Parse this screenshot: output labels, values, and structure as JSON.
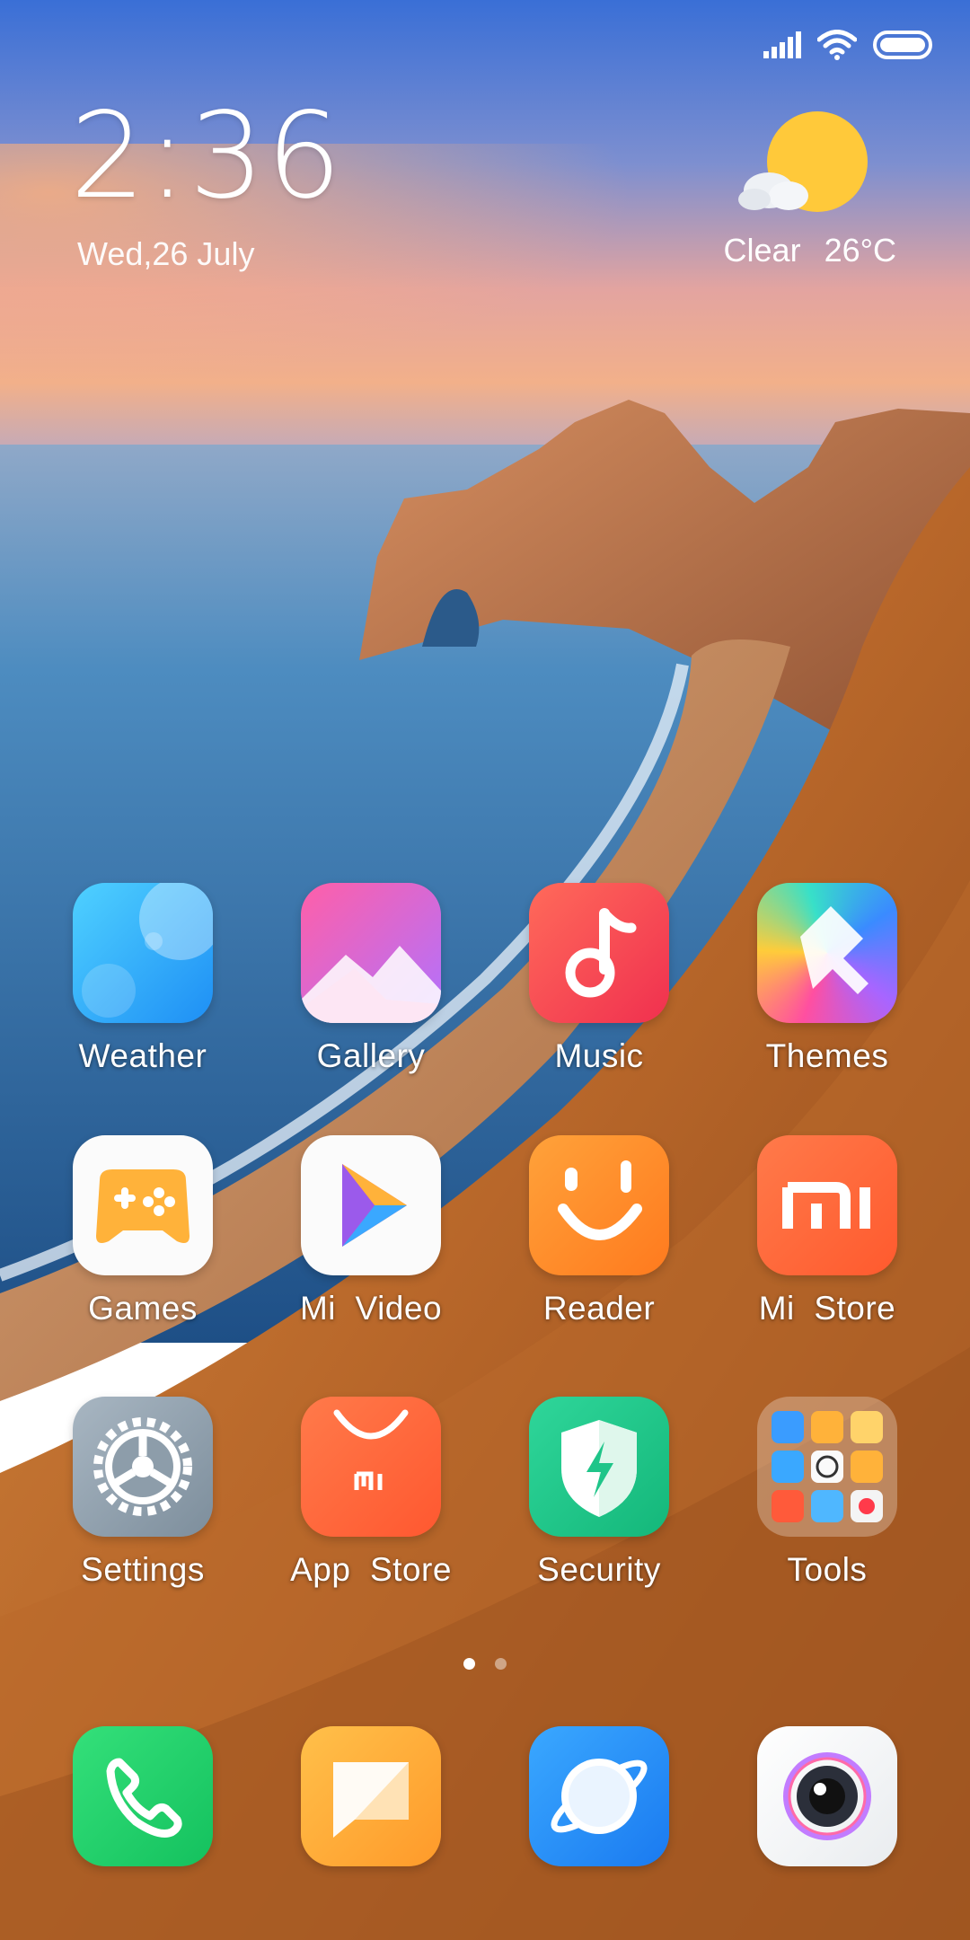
{
  "status_bar": {
    "signal_icon": "signal-icon",
    "wifi_icon": "wifi-icon",
    "battery_icon": "battery-icon"
  },
  "widget": {
    "time": "2:36",
    "date": "Wed,26 July",
    "weather_condition": "Clear",
    "temperature": "26°C",
    "weather_icon": "sun-cloud-icon"
  },
  "apps": {
    "weather": "Weather",
    "gallery": "Gallery",
    "music": "Music",
    "themes": "Themes",
    "games": "Games",
    "mi_video": "Mi  Video",
    "reader": "Reader",
    "mi_store": "Mi  Store",
    "settings": "Settings",
    "app_store": "App  Store",
    "security": "Security",
    "tools": "Tools"
  },
  "page_indicator": {
    "pages": 2,
    "current": 1
  },
  "dock": {
    "phone_icon": "phone-icon",
    "messages_icon": "messages-icon",
    "browser_icon": "browser-icon",
    "camera_icon": "camera-icon"
  },
  "colors": {
    "sky_top": "#3a6fd6",
    "sunset": "#f4a679",
    "sea": "#2a6fa8",
    "grass": "#c9772f",
    "sun": "#ffc93a"
  }
}
